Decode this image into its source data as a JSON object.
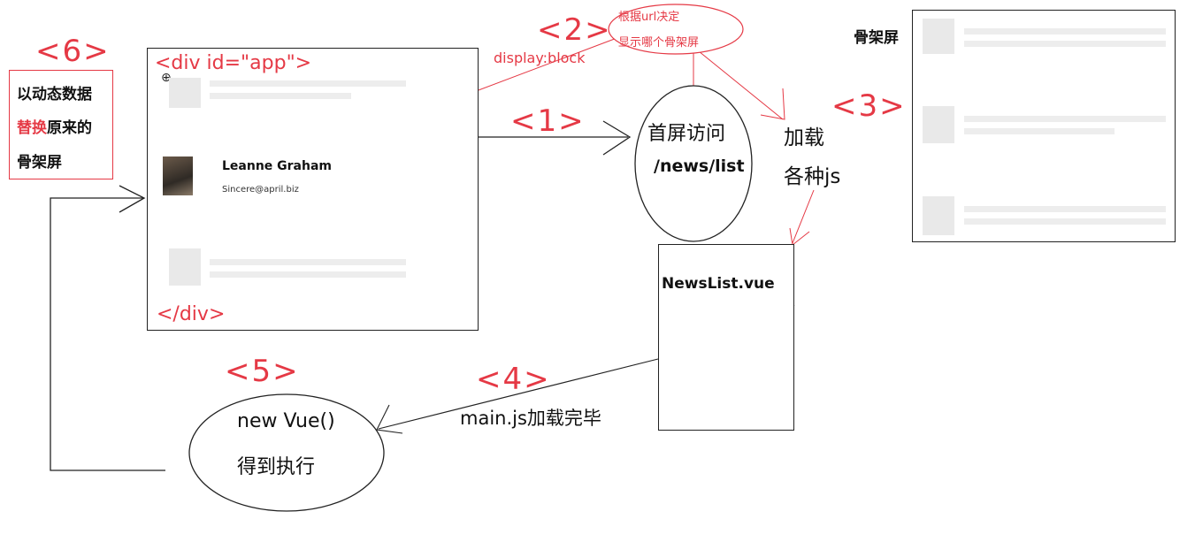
{
  "steps": {
    "s1": "<1>",
    "s2": "<2>",
    "s3": "<3>",
    "s4": "<4>",
    "s5": "<5>",
    "s6": "<6>"
  },
  "app_box": {
    "open_tag": "<div id=\"app\">",
    "close_tag": "</div>",
    "user_name": "Leanne Graham",
    "user_email": "Sincere@april.biz"
  },
  "display_label": "display:block",
  "decide_bubble": {
    "line1": "根据url决定",
    "line2": "显示哪个骨架屏"
  },
  "first_visit": {
    "line1": "首屏访问",
    "line2": "/news/list"
  },
  "load_js": {
    "line1": "加载",
    "line2": "各种js"
  },
  "skeleton_title": "骨架屏",
  "newslist_title": "NewsList.vue",
  "mainjs_label": "main.js加载完毕",
  "vue_ellipse": {
    "line1": "new Vue()",
    "line2": "得到执行"
  },
  "replace_box": {
    "line1": "以动态数据",
    "line2_red": "替换",
    "line2_rest": "原来的",
    "line3": "骨架屏"
  },
  "colors": {
    "accent": "#e53945",
    "stroke": "#222222",
    "skeleton": "#e9e9e9"
  }
}
